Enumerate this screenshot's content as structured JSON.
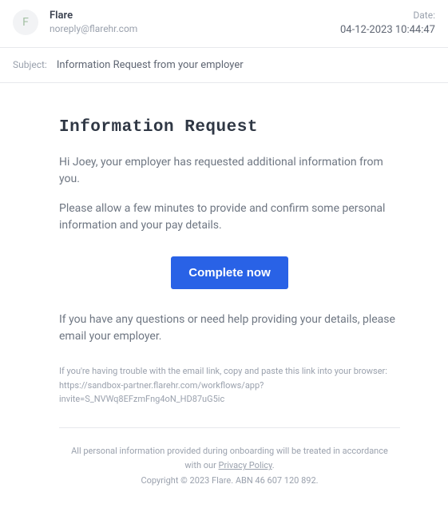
{
  "header": {
    "avatar_initial": "F",
    "sender_name": "Flare",
    "sender_email": "noreply@flarehr.com",
    "date_label": "Date:",
    "date_value": "04-12-2023 10:44:47"
  },
  "subject": {
    "label": "Subject:",
    "text": "Information Request from your employer"
  },
  "body": {
    "title": "Information Request",
    "greeting": "Hi Joey, your employer has requested additional information from you.",
    "instruction": "Please allow a few minutes to provide and confirm some personal information and your pay details.",
    "cta_label": "Complete now",
    "help_text": "If you have any questions or need help providing your details, please email your employer.",
    "trouble_intro": "If you're having trouble with the email link, copy and paste this link into your browser:",
    "trouble_url": "https://sandbox-partner.flarehr.com/workflows/app?invite=S_NVWq8EFzmFng4oN_HD87uG5ic"
  },
  "footer": {
    "disclaimer_pre": "All personal information provided during onboarding will be treated in accordance with our ",
    "privacy_link": "Privacy Policy",
    "disclaimer_post": ".",
    "copyright": "Copyright © 2023 Flare. ABN 46 607 120 892."
  }
}
